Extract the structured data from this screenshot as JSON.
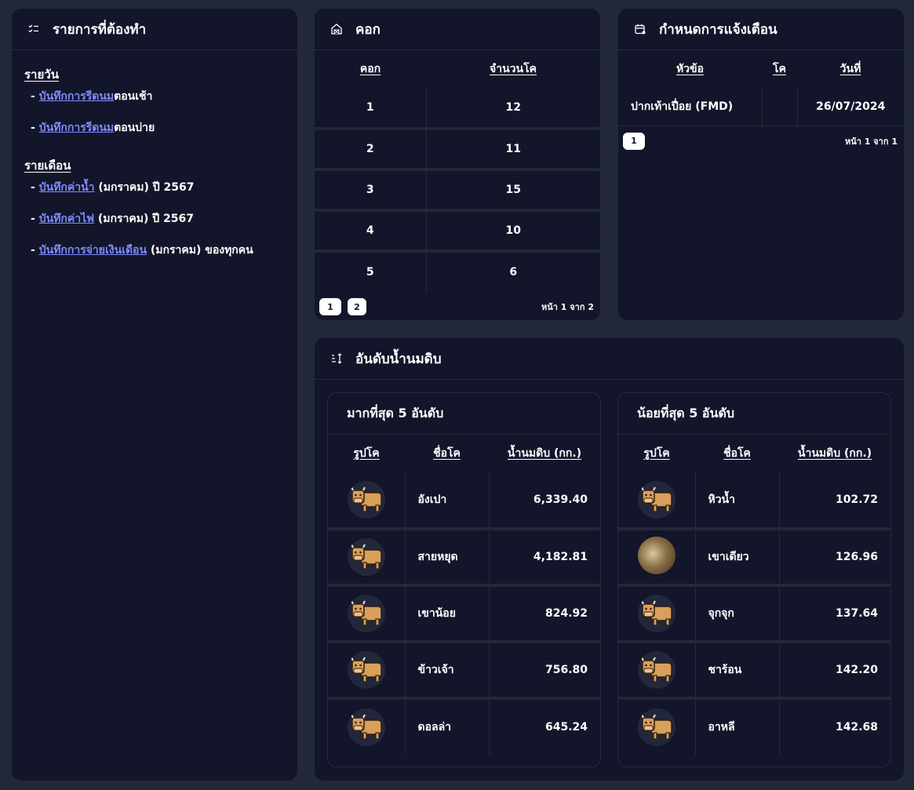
{
  "todo": {
    "title": "รายการที่ต้องทำ",
    "daily_heading": "รายวัน",
    "daily": [
      {
        "link": "บันทึกการรีดนม",
        "rest": "ตอนเช้า"
      },
      {
        "link": "บันทึกการรีดนม",
        "rest": "ตอนบ่าย"
      }
    ],
    "monthly_heading": "รายเดือน",
    "monthly": [
      {
        "link": "บันทึกค่าน้ำ",
        "rest": " (มกราคม) ปี 2567"
      },
      {
        "link": "บันทึกค่าไฟ",
        "rest": " (มกราคม) ปี 2567"
      },
      {
        "link": "บันทึกการจ่ายเงินเดือน",
        "rest": " (มกราคม) ของทุกคน"
      }
    ]
  },
  "coop": {
    "title": "คอก",
    "headers": [
      "คอก",
      "จำนวนโค"
    ],
    "rows": [
      [
        "1",
        "12"
      ],
      [
        "2",
        "11"
      ],
      [
        "3",
        "15"
      ],
      [
        "4",
        "10"
      ],
      [
        "5",
        "6"
      ]
    ],
    "pages": [
      "1",
      "2"
    ],
    "page_info": "หน้า 1 จาก 2"
  },
  "reminder": {
    "title": "กำหนดการแจ้งเตือน",
    "headers": [
      "หัวข้อ",
      "โค",
      "วันที่"
    ],
    "rows": [
      [
        "ปากเท้าเปื่อย (FMD)",
        "",
        "26/07/2024"
      ]
    ],
    "pages": [
      "1"
    ],
    "page_info": "หน้า 1 จาก 1"
  },
  "milk": {
    "title": "อันดับน้ำนมดิบ",
    "top": {
      "title": "มากที่สุด 5 อันดับ",
      "headers": [
        "รูปโค",
        "ชื่อโค",
        "น้ำนมดิบ (กก.)"
      ],
      "rows": [
        {
          "name": "อังเปา",
          "value": "6,339.40",
          "photo": false
        },
        {
          "name": "สายหยุด",
          "value": "4,182.81",
          "photo": false
        },
        {
          "name": "เขาน้อย",
          "value": "824.92",
          "photo": false
        },
        {
          "name": "ข้าวเจ้า",
          "value": "756.80",
          "photo": false
        },
        {
          "name": "ดอลล่า",
          "value": "645.24",
          "photo": false
        }
      ]
    },
    "bottom": {
      "title": "น้อยที่สุด 5 อันดับ",
      "headers": [
        "รูปโค",
        "ชื่อโค",
        "น้ำนมดิบ (กก.)"
      ],
      "rows": [
        {
          "name": "หิวน้ำ",
          "value": "102.72",
          "photo": false
        },
        {
          "name": "เขาเดียว",
          "value": "126.96",
          "photo": true
        },
        {
          "name": "จุกจุก",
          "value": "137.64",
          "photo": false
        },
        {
          "name": "ชาร้อน",
          "value": "142.20",
          "photo": false
        },
        {
          "name": "อาหลี",
          "value": "142.68",
          "photo": false
        }
      ]
    }
  }
}
